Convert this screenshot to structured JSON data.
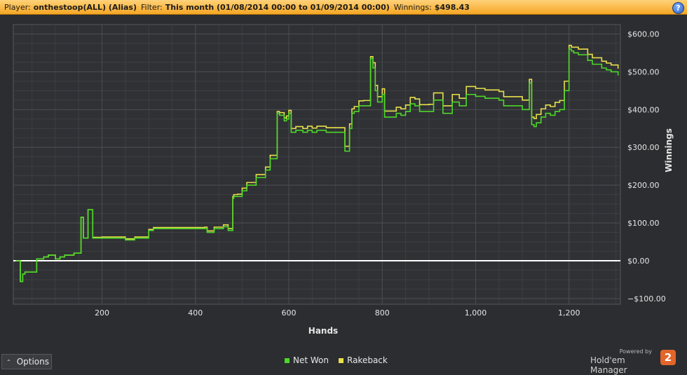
{
  "header": {
    "player_label": "Player:",
    "player_value": "onthestoop(ALL) (Alias)",
    "filter_label": "Filter:",
    "filter_value": "This month (01/08/2014 00:00 to 01/09/2014 00:00)",
    "winnings_label": "Winnings:",
    "winnings_value": "$498.43",
    "help_glyph": "?"
  },
  "options_button": {
    "label": "Options",
    "caret": "⌃"
  },
  "branding": {
    "powered_by": "Powered by",
    "name": "Hold'em Manager",
    "logo_text": "2"
  },
  "colors": {
    "net_won": "#4cd829",
    "rakeback": "#e8e04a",
    "zero_line": "#ffffff",
    "plot_bg": "#2f3134",
    "grid": "#4a4d52",
    "text": "#e6e6e6"
  },
  "chart_data": {
    "type": "line",
    "title": "",
    "xlabel": "Hands",
    "ylabel": "Winnings",
    "xlim": [
      10,
      1310
    ],
    "ylim": [
      -115,
      625
    ],
    "x_ticks": [
      200,
      400,
      600,
      800,
      1000,
      1200
    ],
    "x_tick_labels": [
      "200",
      "400",
      "600",
      "800",
      "1,000",
      "1,200"
    ],
    "y_ticks": [
      -100,
      0,
      100,
      200,
      300,
      400,
      500,
      600
    ],
    "y_tick_labels": [
      "−$100.00",
      "$0.00",
      "$100.00",
      "$200.00",
      "$300.00",
      "$400.00",
      "$500.00",
      "$600.00"
    ],
    "y_axis_side": "right",
    "grid": true,
    "legend_position": "bottom-center",
    "series": [
      {
        "name": "Net Won",
        "x": [
          15,
          25,
          30,
          35,
          45,
          60,
          75,
          85,
          100,
          110,
          120,
          140,
          155,
          160,
          165,
          170,
          180,
          185,
          200,
          220,
          250,
          270,
          300,
          310,
          340,
          360,
          390,
          420,
          425,
          440,
          460,
          470,
          480,
          482,
          490,
          500,
          510,
          530,
          550,
          560,
          575,
          580,
          585,
          590,
          595,
          600,
          605,
          615,
          625,
          630,
          640,
          650,
          660,
          680,
          700,
          720,
          730,
          735,
          740,
          750,
          760,
          775,
          780,
          785,
          790,
          800,
          805,
          820,
          830,
          840,
          850,
          860,
          870,
          880,
          900,
          910,
          930,
          950,
          965,
          980,
          1000,
          1020,
          1040,
          1050,
          1060,
          1080,
          1100,
          1110,
          1115,
          1120,
          1125,
          1130,
          1140,
          1150,
          1160,
          1170,
          1180,
          1190,
          1200,
          1205,
          1210,
          1220,
          1240,
          1250,
          1270,
          1280,
          1290,
          1305
        ],
        "values": [
          0,
          -55,
          -35,
          -30,
          -30,
          5,
          10,
          15,
          5,
          10,
          15,
          20,
          115,
          60,
          60,
          135,
          60,
          60,
          60,
          60,
          55,
          60,
          80,
          85,
          85,
          85,
          85,
          85,
          75,
          85,
          90,
          80,
          165,
          170,
          170,
          185,
          200,
          220,
          240,
          270,
          390,
          385,
          385,
          370,
          375,
          390,
          340,
          345,
          345,
          340,
          345,
          340,
          345,
          340,
          340,
          290,
          350,
          390,
          395,
          410,
          410,
          535,
          510,
          450,
          420,
          440,
          380,
          380,
          390,
          385,
          395,
          415,
          410,
          395,
          395,
          425,
          390,
          420,
          410,
          440,
          435,
          430,
          430,
          425,
          410,
          410,
          400,
          400,
          470,
          360,
          355,
          365,
          380,
          390,
          385,
          395,
          400,
          450,
          560,
          555,
          550,
          545,
          530,
          520,
          510,
          505,
          500,
          490
        ]
      },
      {
        "name": "Rakeback",
        "x": [
          15,
          25,
          30,
          35,
          45,
          60,
          75,
          85,
          100,
          110,
          120,
          140,
          155,
          160,
          165,
          170,
          180,
          185,
          200,
          220,
          250,
          270,
          300,
          310,
          340,
          360,
          390,
          420,
          425,
          440,
          460,
          470,
          480,
          482,
          490,
          500,
          510,
          530,
          550,
          560,
          575,
          580,
          585,
          590,
          595,
          600,
          605,
          615,
          625,
          630,
          640,
          650,
          660,
          680,
          700,
          720,
          730,
          735,
          740,
          750,
          760,
          775,
          780,
          785,
          790,
          800,
          805,
          820,
          830,
          840,
          850,
          860,
          870,
          880,
          900,
          910,
          930,
          950,
          965,
          980,
          1000,
          1020,
          1040,
          1050,
          1060,
          1080,
          1100,
          1110,
          1115,
          1120,
          1125,
          1130,
          1140,
          1150,
          1160,
          1170,
          1180,
          1190,
          1200,
          1205,
          1210,
          1220,
          1240,
          1250,
          1270,
          1280,
          1290,
          1305
        ],
        "values": [
          0,
          -55,
          -35,
          -30,
          -30,
          5,
          10,
          15,
          5,
          10,
          15,
          20,
          115,
          60,
          60,
          135,
          62,
          62,
          63,
          63,
          58,
          63,
          83,
          88,
          88,
          88,
          88,
          89,
          79,
          89,
          95,
          85,
          170,
          175,
          176,
          192,
          207,
          228,
          248,
          279,
          395,
          392,
          392,
          378,
          383,
          398,
          350,
          355,
          355,
          350,
          356,
          351,
          356,
          352,
          352,
          303,
          362,
          402,
          408,
          423,
          424,
          540,
          524,
          464,
          434,
          455,
          396,
          396,
          406,
          402,
          412,
          432,
          428,
          413,
          414,
          444,
          410,
          440,
          430,
          461,
          456,
          452,
          452,
          448,
          434,
          434,
          425,
          425,
          480,
          380,
          376,
          387,
          402,
          412,
          408,
          419,
          424,
          475,
          570,
          565,
          565,
          560,
          546,
          537,
          528,
          523,
          518,
          508
        ]
      }
    ]
  }
}
